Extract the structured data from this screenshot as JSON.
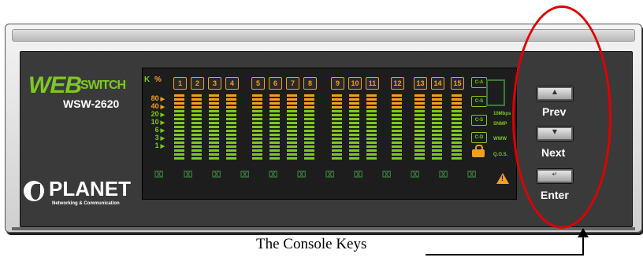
{
  "brand": {
    "logo_web": "WEB",
    "logo_switch": "SWITCH",
    "model": "WSW-2620",
    "maker": "PLANET",
    "tagline": "Networking & Communication"
  },
  "display": {
    "unit_k": "K",
    "unit_pct": "%",
    "scale": [
      {
        "label": "80",
        "color": "#f0a020"
      },
      {
        "label": "40",
        "color": "#f0a020"
      },
      {
        "label": "20",
        "color": "#7ec820"
      },
      {
        "label": "10",
        "color": "#7ec820"
      },
      {
        "label": "6",
        "color": "#7ec820"
      },
      {
        "label": "3",
        "color": "#7ec820"
      },
      {
        "label": "1",
        "color": "#7ec820"
      }
    ],
    "ports": [
      "1",
      "2",
      "3",
      "4",
      "5",
      "6",
      "7",
      "8",
      "9",
      "10",
      "11",
      "12",
      "13",
      "14",
      "15"
    ],
    "side_buttons": [
      "C-A",
      "C-S",
      "C-S",
      "C-D"
    ],
    "side_labels": [
      "10Mbps",
      "SNMP",
      "WWW",
      "Q.O.S."
    ],
    "seg_char": "⌧"
  },
  "keys": [
    {
      "glyph": "▲",
      "label": "Prev"
    },
    {
      "glyph": "▼",
      "label": "Next"
    },
    {
      "glyph": "↵",
      "label": "Enter"
    }
  ],
  "annotation": {
    "caption": "The Console Keys"
  },
  "colors": {
    "accent_green": "#7ec820",
    "accent_orange": "#f0a020",
    "highlight_red": "#e00000"
  }
}
